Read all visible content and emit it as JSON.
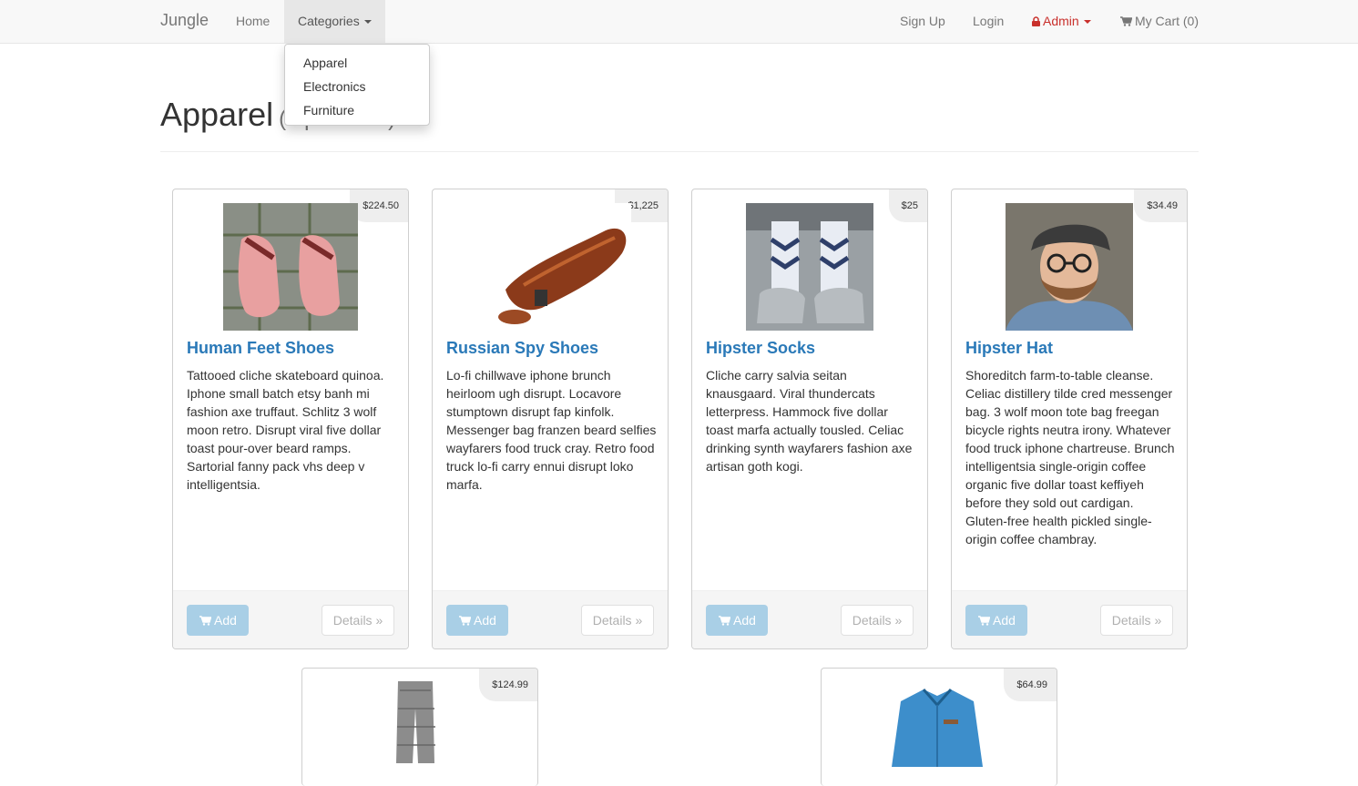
{
  "nav": {
    "brand": "Jungle",
    "home": "Home",
    "categories": "Categories",
    "sign_up": "Sign Up",
    "login": "Login",
    "admin": "Admin",
    "cart": "My Cart (0)"
  },
  "dropdown": {
    "items": [
      "Apparel",
      "Electronics",
      "Furniture"
    ]
  },
  "header": {
    "title": "Apparel",
    "count": "(6 products)"
  },
  "products": [
    {
      "name": "Human Feet Shoes",
      "price": "$224.50",
      "description": "Tattooed cliche skateboard quinoa. Iphone small batch etsy banh mi fashion axe truffaut. Schlitz 3 wolf moon retro. Disrupt viral five dollar toast pour-over beard ramps. Sartorial fanny pack vhs deep v intelligentsia.",
      "add_label": "Add",
      "details_label": "Details »"
    },
    {
      "name": "Russian Spy Shoes",
      "price": "$1,225",
      "description": "Lo-fi chillwave iphone brunch heirloom ugh disrupt. Locavore stumptown disrupt fap kinfolk. Messenger bag franzen beard selfies wayfarers food truck cray. Retro food truck lo-fi carry ennui disrupt loko marfa.",
      "add_label": "Add",
      "details_label": "Details »"
    },
    {
      "name": "Hipster Socks",
      "price": "$25",
      "description": "Cliche carry salvia seitan knausgaard. Viral thundercats letterpress. Hammock five dollar toast marfa actually tousled. Celiac drinking synth wayfarers fashion axe artisan goth kogi.",
      "add_label": "Add",
      "details_label": "Details »"
    },
    {
      "name": "Hipster Hat",
      "price": "$34.49",
      "description": "Shoreditch farm-to-table cleanse. Celiac distillery tilde cred messenger bag. 3 wolf moon tote bag freegan bicycle rights neutra irony. Whatever food truck iphone chartreuse. Brunch intelligentsia single-origin coffee organic five dollar toast keffiyeh before they sold out cardigan. Gluten-free health pickled single-origin coffee chambray.",
      "add_label": "Add",
      "details_label": "Details »"
    },
    {
      "price": "$124.99"
    },
    {
      "price": "$64.99"
    }
  ],
  "colors": {
    "link": "#2a79b8",
    "admin": "#c9302c",
    "add_button": "#a9cfe6"
  }
}
